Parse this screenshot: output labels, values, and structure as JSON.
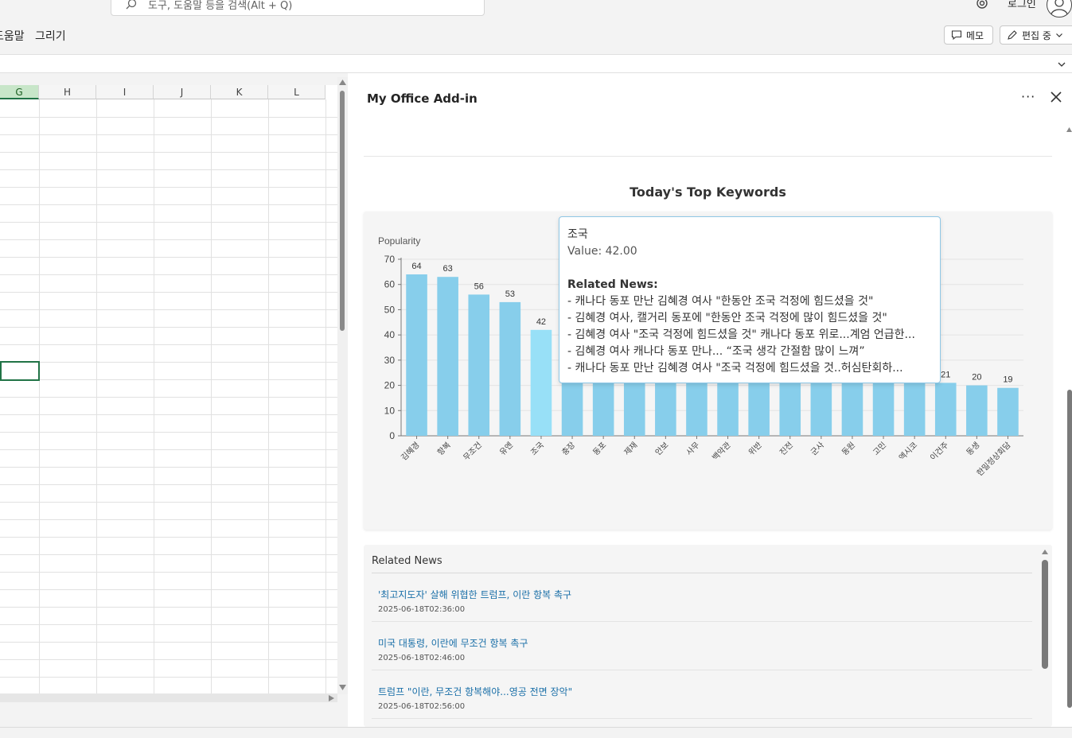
{
  "search": {
    "placeholder": "도구, 도움말 등을 검색(Alt + Q)"
  },
  "header": {
    "login_label": "로그인"
  },
  "ribbon": {
    "tabs": [
      "도움말",
      "그리기"
    ],
    "memo_label": "메모",
    "edit_label": "편집 중"
  },
  "grid": {
    "columns": [
      "G",
      "H",
      "I",
      "J",
      "K",
      "L"
    ],
    "selected_column": "G"
  },
  "pane": {
    "title": "My Office Add-in",
    "more_label": "···"
  },
  "chart_data": {
    "type": "bar",
    "title": "Today's Top Keywords",
    "ylabel": "Popularity",
    "xlabel": "",
    "ylim": [
      0,
      70
    ],
    "yticks": [
      0,
      10,
      20,
      30,
      40,
      50,
      60,
      70
    ],
    "grid": true,
    "categories": [
      "김혜경",
      "항복",
      "무조건",
      "유엔",
      "조국",
      "충장",
      "동포",
      "제재",
      "안보",
      "사무",
      "백악관",
      "위반",
      "진전",
      "군사",
      "동원",
      "고민",
      "엑시코",
      "이건주",
      "동생",
      "한밀정상회담"
    ],
    "values": [
      64,
      63,
      56,
      53,
      42,
      35,
      34,
      33,
      32,
      31,
      30,
      29,
      28,
      27,
      26,
      25,
      24,
      21,
      20,
      19
    ],
    "visible_value_labels": [
      64,
      63,
      56,
      53,
      42,
      null,
      null,
      null,
      null,
      null,
      null,
      null,
      null,
      null,
      null,
      null,
      null,
      21,
      20,
      19
    ],
    "highlighted_category": "조국",
    "bar_color": "#87ceeb",
    "highlight_color": "#98e0f7"
  },
  "tooltip": {
    "keyword": "조국",
    "value_text": "Value: 42.00",
    "related_label": "Related News:",
    "items": [
      "- 캐나다 동포 만난 김혜경 여사 \"한동안 조국 걱정에 힘드셨을 것\"",
      "- 김혜경 여사, 캘거리 동포에 \"한동안 조국 걱정에 많이 힘드셨을 것\"",
      "- 김혜경 여사 \"조국 걱정에 힘드셨을 것\" 캐나다 동포 위로...계엄 언급한...",
      "- 김혜경 여사 캐나다 동포 만나... “조국 생각 간절함 많이 느껴”",
      "- 캐나다 동포 만난 김혜경 여사 \"조국 걱정에 힘드셨을 것..허심탄회하..."
    ]
  },
  "news": {
    "title": "Related News",
    "items": [
      {
        "title": "'최고지도자' 살해 위협한 트럼프, 이란 항복 촉구",
        "date": "2025-06-18T02:36:00"
      },
      {
        "title": "미국 대통령, 이란에 무조건 항복 촉구",
        "date": "2025-06-18T02:46:00"
      },
      {
        "title": "트럼프 \"이란, 무조건 항복해야...영공 전면 장악\"",
        "date": "2025-06-18T02:56:00"
      }
    ]
  }
}
